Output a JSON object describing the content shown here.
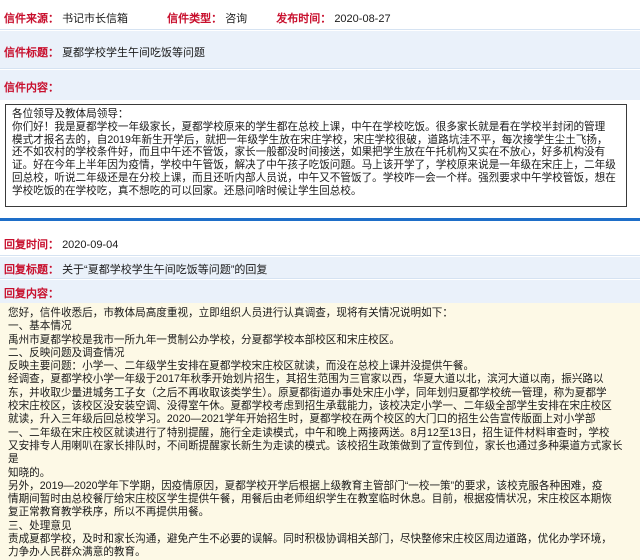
{
  "letter": {
    "source_label": "信件来源：",
    "source_value": "书记市长信箱",
    "type_label": "信件类型：",
    "type_value": "咨询",
    "date_label": "发布时间：",
    "date_value": "2020-08-27",
    "title_label": "信件标题：",
    "title_value": "夏都学校学生午间吃饭等问题",
    "content_label": "信件内容：",
    "content_lines": [
      "各位领导及教体局领导：",
      "  你们好！我是夏都学校一年级家长，夏都学校原来的学生都在总校上课，中午在学校吃饭。很多家长就是看在学校半封闭的管理",
      "模式才报名去的，自2019年新生开学后，就把一年级学生放在宋庄学校，宋庄学校很破，道路坑洼不平，每次接学生尘土飞扬，",
      "还不如农村的学校条件好，而且中午还不管饭，家长一般都没时间接送，如果把学生放在午托机构又实在不放心，好多机构没有",
      "证。好在今年上半年因为疫情，学校中午管饭，解决了中午孩子吃饭问题。马上该开学了，学校原来说是一年级在宋庄上，二年级",
      "回总校，听说二年级还是在分校上课，而且还听内部人员说，中午又不管饭了。学校咋一会一个样。强烈要求中午学校管饭，想在",
      "学校吃饭的在学校吃，真不想吃的可以回家。还恳问啥时候让学生回总校。"
    ]
  },
  "reply": {
    "time_label": "回复时间：",
    "time_value": "2020-09-04",
    "title_label": "回复标题：",
    "title_value": "关于“夏都学校学生午间吃饭等问题”的回复",
    "content_label": "回复内容：",
    "content_lines": [
      "您好，信件收悉后，市教体局高度重视，立即组织人员进行认真调查，现将有关情况说明如下：",
      "一、基本情况",
      "禹州市夏都学校是我市一所九年一贯制公办学校，分夏都学校本部校区和宋庄校区。",
      "二、反映问题及调查情况",
      "反映主要问题：小学一、二年级学生安排在夏都学校宋庄校区就读，而没在总校上课并没提供午餐。",
      "经调查，夏都学校小学一年级于2017年秋季开始划片招生，其招生范围为三官家以西，华夏大道以北，滨河大道以南，振兴路以",
      "东，并收取少量进城务工子女（之后不再收取该类学生）。原夏都街道办事处宋庄小学，同年划归夏都学校统一管理，称为夏都学",
      "校宋庄校区，该校区没安装空调、没得室午休。夏都学校考虑到招生承载能力，该校决定小学一、二年级全部学生安排在宋庄校区",
      "就读，升入三年级后回总校学习。2020—2021学年开始招生时，夏都学校在两个校区的大门口的招生公告宣传版面上对小学部",
      "一、二年级在宋庄校区就读进行了特别提醒，施行全走读模式，中午和晚上两接两送。8月12至13日，招生证件材料审查时，学校",
      "又安排专人用喇叭在家长排队时，不间断提醒家长新生为走读的模式。该校招生政策做到了宣传到位，家长也通过多种渠道方式家长是",
      "知晓的。",
      "另外，2019—2020学年下学期，因疫情原因，夏都学校开学后根据上级教育主管部门“一校一策”的要求，该校克服各种困难，疫",
      "情期间暂时由总校餐厅给宋庄校区学生提供午餐，用餐后由老师组织学生在教室临时休息。目前，根据疫情状况，宋庄校区本期恢",
      "复正常教育教学秩序，所以不再提供用餐。",
      "三、处理意见",
      "责成夏都学校，及时和家长沟通，避免产生不必要的误解。同时积极协调相关部门，尽快整修宋庄校区周边道路，优化办学环境，",
      "力争办人民群众满意的教育。"
    ]
  }
}
